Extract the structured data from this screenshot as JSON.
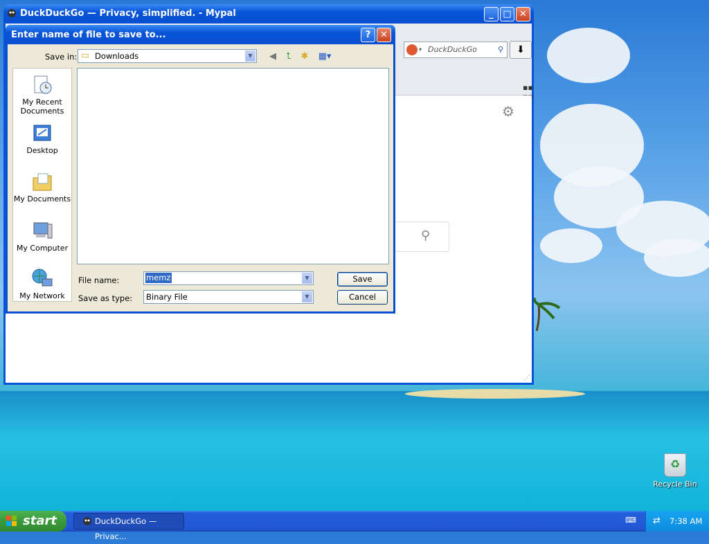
{
  "browser": {
    "title": "DuckDuckGo — Privacy, simplified. - Mypal",
    "search_placeholder": "DuckDuckGo",
    "search_icon": "magnifier-icon",
    "download_icon": "download-arrow-icon"
  },
  "dialog": {
    "title": "Enter name of file to save to...",
    "save_in_label": "Save in:",
    "save_in_value": "Downloads",
    "file_name_label": "File name:",
    "file_name_value": "memz",
    "save_as_type_label": "Save as type:",
    "save_as_type_value": "Binary File",
    "save_button": "Save",
    "cancel_button": "Cancel",
    "places": [
      {
        "label": "My Recent Documents",
        "icon": "recent-documents-icon"
      },
      {
        "label": "Desktop",
        "icon": "desktop-icon"
      },
      {
        "label": "My Documents",
        "icon": "my-documents-icon"
      },
      {
        "label": "My Computer",
        "icon": "my-computer-icon"
      },
      {
        "label": "My Network",
        "icon": "my-network-icon"
      }
    ]
  },
  "desktop": {
    "recycle_bin": "Recycle Bin"
  },
  "taskbar": {
    "start_label": "start",
    "task_label": "DuckDuckGo — Privac...",
    "clock": "7:38 AM"
  },
  "colors": {
    "xp_blue": "#0a4fd0",
    "start_green": "#3a9a3a",
    "dialog_bg": "#ece9d8",
    "selection": "#316ac5"
  }
}
